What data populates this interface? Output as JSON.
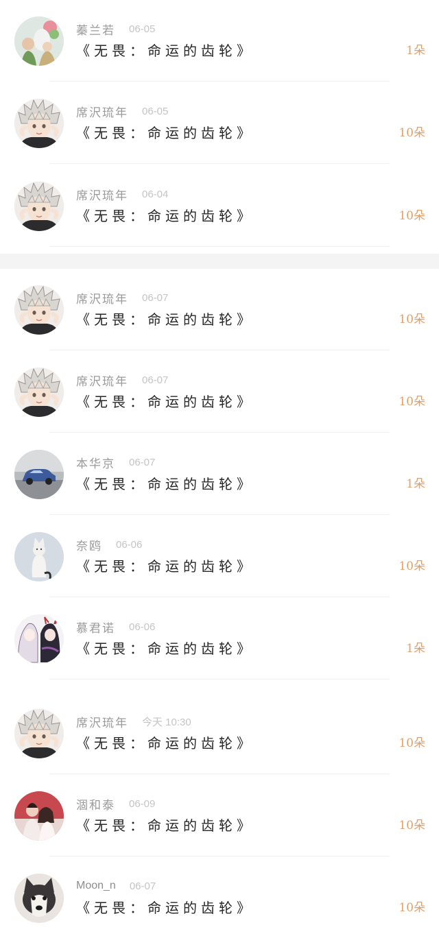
{
  "entries": [
    {
      "avatar": "girl-photo-avatar",
      "name": "蓁兰若",
      "date": "06-05",
      "work": "《无畏：命运的齿轮》",
      "amount": "1朵"
    },
    {
      "avatar": "anime-boy-avatar",
      "name": "席沢琉年",
      "date": "06-05",
      "work": "《无畏：命运的齿轮》",
      "amount": "10朵"
    },
    {
      "avatar": "anime-boy-avatar",
      "name": "席沢琉年",
      "date": "06-04",
      "work": "《无畏：命运的齿轮》",
      "amount": "10朵"
    },
    {
      "avatar": "anime-boy-avatar",
      "name": "席沢琉年",
      "date": "06-07",
      "work": "《无畏：命运的齿轮》",
      "amount": "10朵"
    },
    {
      "avatar": "anime-boy-avatar",
      "name": "席沢琉年",
      "date": "06-07",
      "work": "《无畏：命运的齿轮》",
      "amount": "10朵"
    },
    {
      "avatar": "blue-car-avatar",
      "name": "本华京",
      "date": "06-07",
      "work": "《无畏：命运的齿轮》",
      "amount": "1朵"
    },
    {
      "avatar": "white-cat-avatar",
      "name": "奈鸥",
      "date": "06-06",
      "work": "《无畏：命运的齿轮》",
      "amount": "10朵"
    },
    {
      "avatar": "anime-pair-avatar",
      "name": "慕君诺",
      "date": "06-06",
      "work": "《无畏：命运的齿轮》",
      "amount": "1朵"
    },
    {
      "avatar": "anime-boy-avatar",
      "name": "席沢琉年",
      "date": "今天 10:30",
      "work": "《无畏：命运的齿轮》",
      "amount": "10朵"
    },
    {
      "avatar": "couple-photo-avatar",
      "name": "涸和泰",
      "date": "06-09",
      "work": "《无畏：命运的齿轮》",
      "amount": "10朵"
    },
    {
      "avatar": "husky-dog-avatar",
      "name": "Moon_n",
      "date": "06-07",
      "work": "《无畏：命运的齿轮》",
      "amount": "10朵"
    }
  ],
  "colors": {
    "name": "#9a9a9a",
    "date": "#c4c4c4",
    "work": "#262626",
    "amount": "#e0a06c",
    "background": "#f4f4f4",
    "card": "#ffffff"
  }
}
